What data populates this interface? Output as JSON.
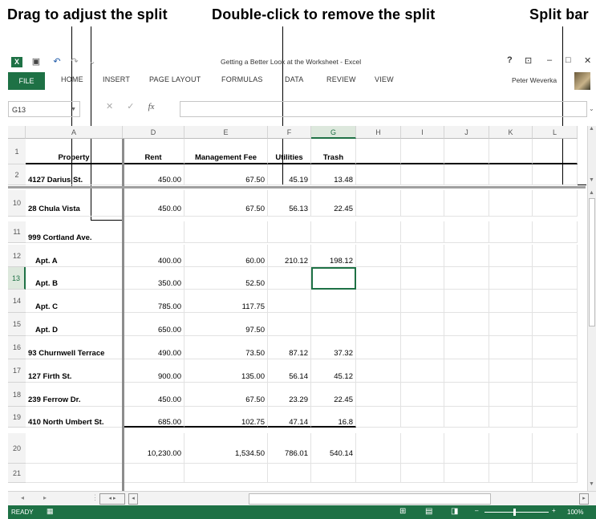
{
  "callouts": {
    "drag": "Drag to adjust the split",
    "dblclick": "Double-click to remove the split",
    "splitbar": "Split bar"
  },
  "window": {
    "title": "Getting a Better Look at the Worksheet - Excel",
    "help": "?",
    "minimize": "–",
    "maximize": "□",
    "close": "✕"
  },
  "ribbon": {
    "tabs": [
      "FILE",
      "HOME",
      "INSERT",
      "PAGE LAYOUT",
      "FORMULAS",
      "DATA",
      "REVIEW",
      "VIEW"
    ],
    "user": "Peter Weverka"
  },
  "formula_bar": {
    "name_box": "G13",
    "fx": "fx",
    "formula": ""
  },
  "grid": {
    "columns": [
      "A",
      "D",
      "E",
      "F",
      "G",
      "H",
      "I",
      "J",
      "K",
      "L"
    ],
    "selected_column": "G",
    "selected_row": "13",
    "rows": [
      {
        "num": "1",
        "cells": [
          "Property",
          "Rent",
          "Management Fee",
          "Utilities",
          "Trash"
        ]
      },
      {
        "num": "2",
        "cells": [
          "4127 Darius St.",
          "450.00",
          "67.50",
          "45.19",
          "13.48"
        ]
      },
      {
        "num": "10",
        "cells": [
          "28 Chula Vista",
          "450.00",
          "67.50",
          "56.13",
          "22.45"
        ]
      },
      {
        "num": "11",
        "cells": [
          "999 Cortland Ave.",
          "",
          "",
          "",
          ""
        ]
      },
      {
        "num": "12",
        "cells": [
          "Apt. A",
          "400.00",
          "60.00",
          "210.12",
          "198.12"
        ]
      },
      {
        "num": "13",
        "cells": [
          "Apt. B",
          "350.00",
          "52.50",
          "",
          ""
        ]
      },
      {
        "num": "14",
        "cells": [
          "Apt. C",
          "785.00",
          "117.75",
          "",
          ""
        ]
      },
      {
        "num": "15",
        "cells": [
          "Apt. D",
          "650.00",
          "97.50",
          "",
          ""
        ]
      },
      {
        "num": "16",
        "cells": [
          "93 Churnwell Terrace",
          "490.00",
          "73.50",
          "87.12",
          "37.32"
        ]
      },
      {
        "num": "17",
        "cells": [
          "127 Firth St.",
          "900.00",
          "135.00",
          "56.14",
          "45.12"
        ]
      },
      {
        "num": "18",
        "cells": [
          "239 Ferrow Dr.",
          "450.00",
          "67.50",
          "23.29",
          "22.45"
        ]
      },
      {
        "num": "19",
        "cells": [
          "410 North Umbert St.",
          "685.00",
          "102.75",
          "47.14",
          "16.8"
        ]
      },
      {
        "num": "20",
        "cells": [
          "",
          "10,230.00",
          "1,534.50",
          "786.01",
          "540.14"
        ]
      },
      {
        "num": "21",
        "cells": [
          "",
          "",
          "",
          "",
          ""
        ]
      }
    ]
  },
  "status": {
    "ready": "READY",
    "zoom": "100%",
    "minus": "–",
    "plus": "+"
  }
}
